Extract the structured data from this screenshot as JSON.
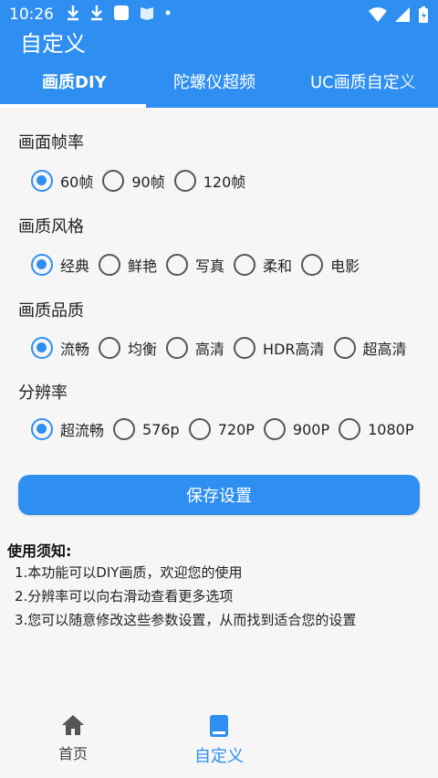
{
  "status_bar": {
    "time": "10:26"
  },
  "app_bar": {
    "title": "自定义"
  },
  "tabs": [
    {
      "label": "画质DIY",
      "active": true
    },
    {
      "label": "陀螺仪超频",
      "active": false
    },
    {
      "label": "UC画质自定义",
      "active": false
    }
  ],
  "sections": {
    "frame_rate": {
      "title": "画面帧率",
      "options": [
        "60帧",
        "90帧",
        "120帧"
      ],
      "selected": 0
    },
    "style": {
      "title": "画质风格",
      "options": [
        "经典",
        "鲜艳",
        "写真",
        "柔和",
        "电影"
      ],
      "selected": 0
    },
    "quality": {
      "title": "画质品质",
      "options": [
        "流畅",
        "均衡",
        "高清",
        "HDR高清",
        "超高清"
      ],
      "selected": 0
    },
    "resolution": {
      "title": "分辨率",
      "options": [
        "超流畅",
        "576p",
        "720P",
        "900P",
        "1080P"
      ],
      "selected": 0
    }
  },
  "save_button": "保存设置",
  "notes": {
    "title": "使用须知:",
    "items": [
      "1.本功能可以DIY画质，欢迎您的使用",
      "2.分辨率可以向右滑动查看更多选项",
      "3.您可以随意修改这些参数设置，从而找到适合您的设置"
    ]
  },
  "bottom_nav": [
    {
      "label": "首页",
      "icon": "home-icon",
      "active": false
    },
    {
      "label": "自定义",
      "icon": "book-icon",
      "active": true
    }
  ],
  "colors": {
    "accent": "#2f8ff0"
  }
}
